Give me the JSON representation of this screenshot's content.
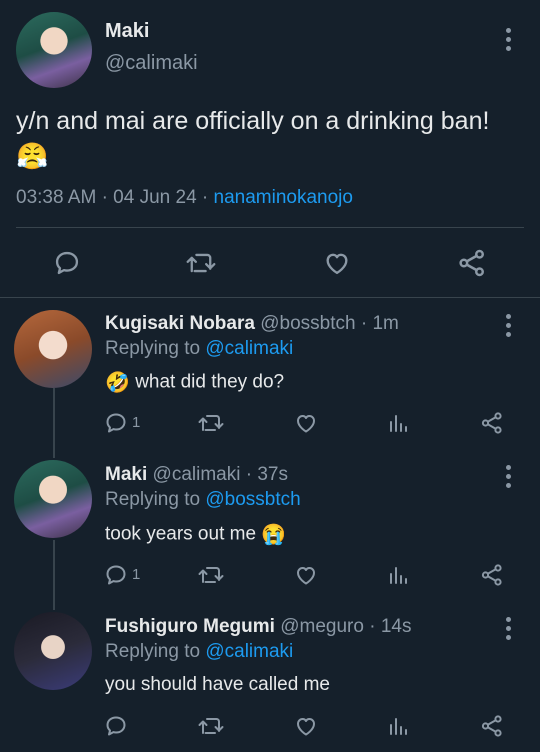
{
  "main_tweet": {
    "author_name": "Maki",
    "handle": "@calimaki",
    "text": "y/n and mai are officially on a drinking ban!",
    "emoji": "😤",
    "time": "03:38 AM",
    "date": "04 Jun 24",
    "source": "nanaminokanojo"
  },
  "replies": [
    {
      "author_name": "Kugisaki Nobara",
      "handle": "@bossbtch",
      "age": "1m",
      "replying_prefix": "Replying to",
      "replying_to": "@calimaki",
      "lead_emoji": "🤣",
      "text": "what did they do?",
      "reply_count": "1"
    },
    {
      "author_name": "Maki",
      "handle": "@calimaki",
      "age": "37s",
      "replying_prefix": "Replying to",
      "replying_to": "@bossbtch",
      "text": "took years out me",
      "trail_emoji": "😭",
      "reply_count": "1"
    },
    {
      "author_name": "Fushiguro Megumi",
      "handle": "@meguro",
      "age": "14s",
      "replying_prefix": "Replying to",
      "replying_to": "@calimaki",
      "text": "you should have called me",
      "reply_count": ""
    }
  ],
  "separators": {
    "dot": "·"
  },
  "colors": {
    "background": "#15202b",
    "text": "#e7e9ea",
    "muted": "#8b98a5",
    "link": "#1d9bf0",
    "divider": "#38444d"
  },
  "icons": [
    "reply-icon",
    "retweet-icon",
    "like-icon",
    "share-icon",
    "analytics-icon",
    "more-icon"
  ]
}
